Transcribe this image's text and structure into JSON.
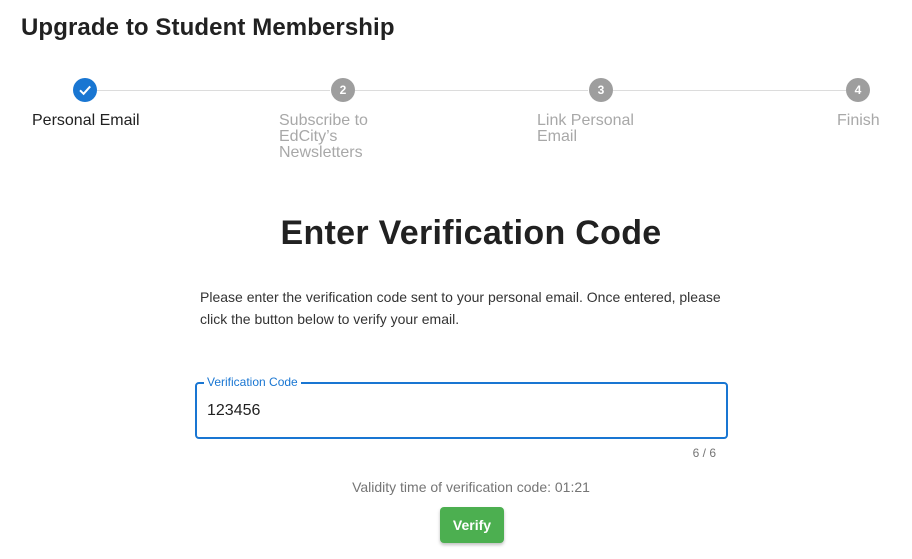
{
  "page": {
    "title": "Upgrade to Student Membership"
  },
  "stepper": {
    "steps": [
      {
        "number": "1",
        "label": "Personal Email",
        "state": "completed",
        "icon": "check-icon"
      },
      {
        "number": "2",
        "label": "Subscribe to EdCity’s Newsletters",
        "label_lines": [
          "Subscribe to",
          "EdCity’s",
          "Newsletters"
        ],
        "state": "pending"
      },
      {
        "number": "3",
        "label": "Link Personal Email",
        "label_lines": [
          "Link Personal",
          "Email"
        ],
        "state": "pending"
      },
      {
        "number": "4",
        "label": "Finish",
        "state": "pending"
      }
    ]
  },
  "main": {
    "heading": "Enter Verification Code",
    "instructions": "Please enter the verification code sent to your personal email. Once entered, please click the button below to verify your email.",
    "field": {
      "label": "Verification Code",
      "value": "123456",
      "counter": "6 / 6"
    },
    "validity": "Validity time of verification code: 01:21",
    "verify_button": "Verify"
  },
  "colors": {
    "accent": "#1976d2",
    "success": "#4caf50",
    "step_pending": "#9e9e9e"
  }
}
